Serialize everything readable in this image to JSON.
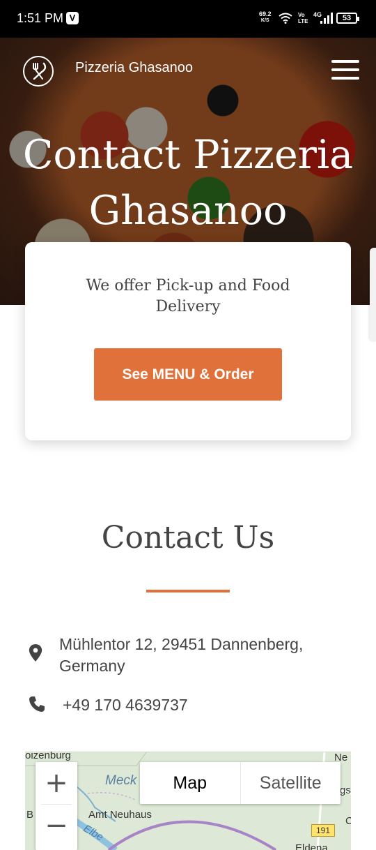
{
  "status_bar": {
    "time": "1:51 PM",
    "net_speed_value": "69.2",
    "net_speed_unit": "K/S",
    "volte_top": "Vo",
    "volte_bottom": "LTE",
    "network": "4G",
    "battery": "53"
  },
  "header": {
    "brand": "Pizzeria Ghasanoo",
    "title_line1": "Contact Pizzeria",
    "title_line2": "Ghasanoo"
  },
  "card": {
    "text": "We offer Pick-up and Food Delivery",
    "button_label": "See MENU & Order"
  },
  "contact": {
    "heading": "Contact Us",
    "address": "Mühlentor 12, 29451 Dannenberg, Germany",
    "phone": "+49 170 4639737",
    "accent_color": "#e0713a"
  },
  "map": {
    "tab_map": "Map",
    "tab_satellite": "Satellite",
    "zoom_in": "+",
    "zoom_out": "−",
    "labels": {
      "top_left": "oizenburg",
      "meck": "Meck",
      "amt_neuhaus": "Amt Neuhaus",
      "elbe": "Elbe",
      "b": "B",
      "ne": "Ne",
      "gs": "gs",
      "c": "C",
      "eldena": "Eldena",
      "road": "191"
    }
  }
}
